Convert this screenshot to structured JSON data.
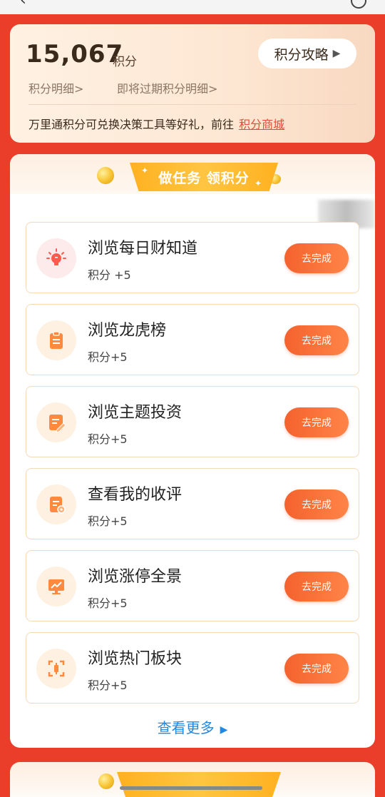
{
  "points": {
    "value": "15,067",
    "unit": "积分",
    "strategy_label": "积分攻略",
    "detail_link": "积分明细>",
    "expiring_link": "即将过期积分明细>",
    "redeem_text": "万里通积分可兑换决策工具等好礼，前往",
    "redeem_link": "积分商城"
  },
  "tasks": {
    "banner_title": "做任务 领积分",
    "items": [
      {
        "title": "浏览每日财知道",
        "points": "积分 +5",
        "button": "去完成",
        "icon": "lightbulb-icon"
      },
      {
        "title": "浏览龙虎榜",
        "points": "积分+5",
        "button": "去完成",
        "icon": "clipboard-icon"
      },
      {
        "title": "浏览主题投资",
        "points": "积分+5",
        "button": "去完成",
        "icon": "edit-document-icon"
      },
      {
        "title": "查看我的收评",
        "points": "积分+5",
        "button": "去完成",
        "icon": "review-document-icon"
      },
      {
        "title": "浏览涨停全景",
        "points": "积分+5",
        "button": "去完成",
        "icon": "trend-monitor-icon"
      },
      {
        "title": "浏览热门板块",
        "points": "积分+5",
        "button": "去完成",
        "icon": "candlestick-icon"
      }
    ],
    "view_more": "查看更多"
  },
  "colors": {
    "page_bg": "#ea3e2b",
    "button_gradient_start": "#f4622e",
    "button_gradient_end": "#ff8447",
    "banner_gold": "#ffb120",
    "link_blue": "#2288e0",
    "link_red": "#e44b3c"
  }
}
